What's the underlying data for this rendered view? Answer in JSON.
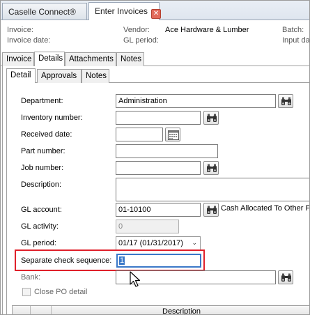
{
  "top_tabs": [
    {
      "label": "Caselle Connect®"
    },
    {
      "label": "Enter Invoices"
    }
  ],
  "header": {
    "invoice_label": "Invoice:",
    "invoice_date_label": "Invoice date:",
    "vendor_label": "Vendor:",
    "vendor_value": "Ace Hardware & Lumber",
    "gl_period_label": "GL period:",
    "batch_label": "Batch:",
    "input_date_label": "Input da"
  },
  "section_tabs": [
    {
      "label": "Invoice"
    },
    {
      "label": "Details"
    },
    {
      "label": "Attachments"
    },
    {
      "label": "Notes"
    }
  ],
  "sub_tabs": [
    {
      "label": "Detail"
    },
    {
      "label": "Approvals"
    },
    {
      "label": "Notes"
    }
  ],
  "form": {
    "department_label": "Department:",
    "department_value": "Administration",
    "inventory_number_label": "Inventory number:",
    "received_date_label": "Received date:",
    "part_number_label": "Part number:",
    "job_number_label": "Job number:",
    "description_label": "Description:",
    "gl_account_label": "GL account:",
    "gl_account_value": "01-10100",
    "gl_account_desc": "Cash Allocated To Other Fu",
    "gl_activity_label": "GL activity:",
    "gl_activity_value": "0",
    "gl_period_label": "GL period:",
    "gl_period_value": "01/17 (01/31/2017)",
    "separate_check_label": "Separate check sequence:",
    "separate_check_value": "1",
    "bank_label": "Bank:",
    "close_po_label": "Close PO detail"
  },
  "grid": {
    "description_header": "Description"
  },
  "colors": {
    "highlight_border": "#e0202a",
    "focus_border": "#3b78c8"
  }
}
